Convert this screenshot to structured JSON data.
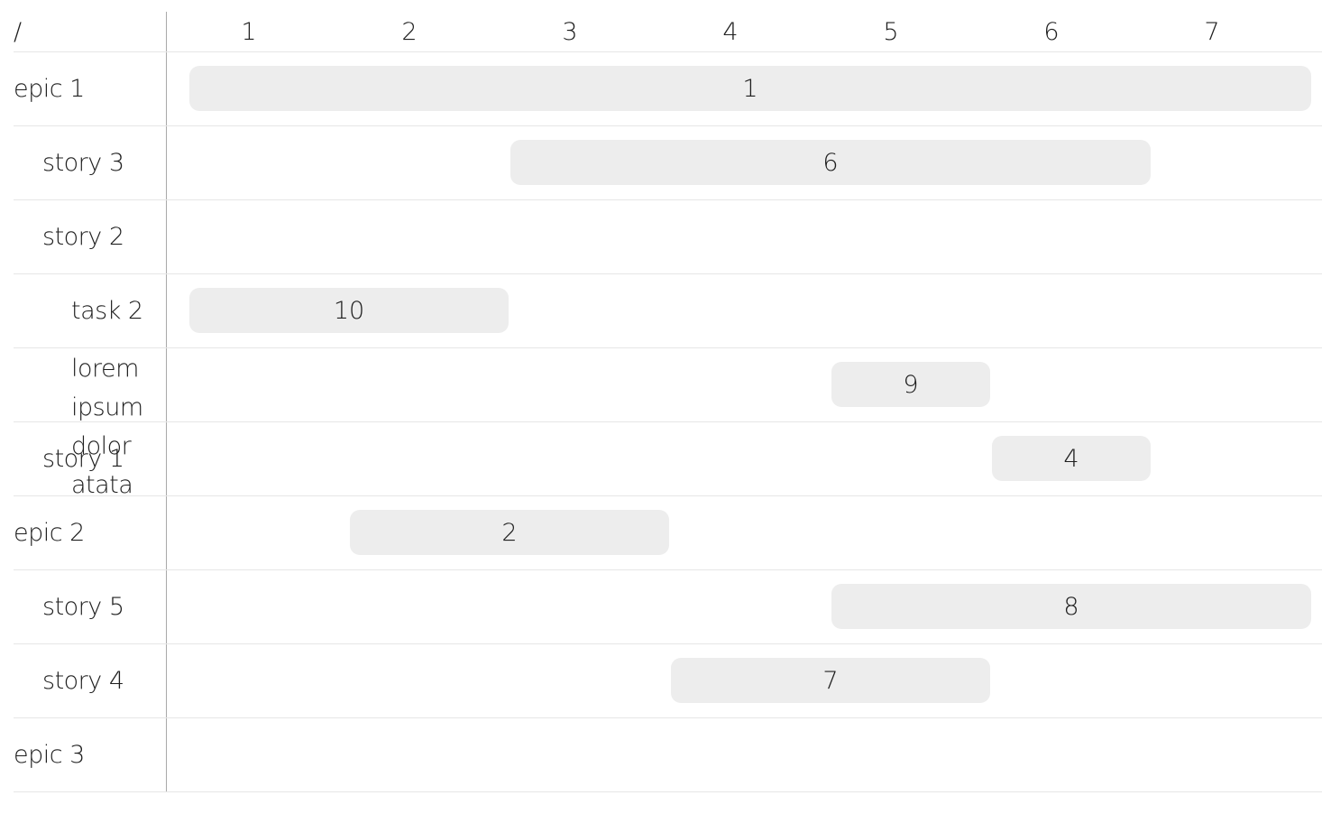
{
  "corner": "/",
  "columns": [
    "1",
    "2",
    "3",
    "4",
    "5",
    "6",
    "7"
  ],
  "rows": [
    {
      "label": "epic 1",
      "level": 0
    },
    {
      "label": "story 3",
      "level": 1
    },
    {
      "label": "story 2",
      "level": 1
    },
    {
      "label": "task 2",
      "level": 2
    },
    {
      "label": "lorem\nipsum\ndolor\natata",
      "level": 2
    },
    {
      "label": "story 1",
      "level": 1
    },
    {
      "label": "epic 2",
      "level": 0
    },
    {
      "label": "story 5",
      "level": 1
    },
    {
      "label": "story 4",
      "level": 1
    },
    {
      "label": "epic 3",
      "level": 0
    }
  ],
  "bars": [
    {
      "row": 0,
      "start": 1,
      "end": 8,
      "label": "1"
    },
    {
      "row": 1,
      "start": 3,
      "end": 7,
      "label": "6"
    },
    {
      "row": 3,
      "start": 1,
      "end": 3,
      "label": "10"
    },
    {
      "row": 4,
      "start": 5,
      "end": 6,
      "label": "9"
    },
    {
      "row": 5,
      "start": 6,
      "end": 7,
      "label": "4"
    },
    {
      "row": 6,
      "start": 2,
      "end": 4,
      "label": "2"
    },
    {
      "row": 7,
      "start": 5,
      "end": 8,
      "label": "8"
    },
    {
      "row": 8,
      "start": 4,
      "end": 6,
      "label": "7"
    }
  ]
}
